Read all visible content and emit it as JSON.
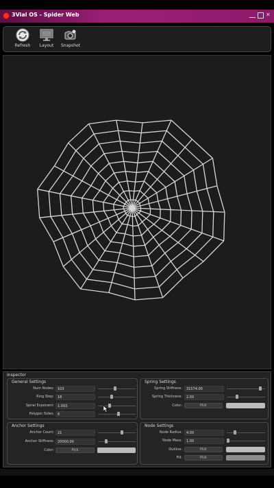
{
  "window": {
    "title": "3Vial OS - Spider Web"
  },
  "toolbar": {
    "refresh": "Refresh",
    "layout": "Layout",
    "snapshot": "Snapshot"
  },
  "inspector": {
    "title": "Inspector",
    "general": {
      "title": "General Settings",
      "num_nodes_label": "Num Nodes:",
      "num_nodes": "103",
      "num_nodes_level": 0.45,
      "ring_step_label": "Ring Step:",
      "ring_step": "18",
      "ring_step_level": 0.35,
      "spiral_exponent_label": "Spiral Exponent:",
      "spiral_exponent": "1.003",
      "spiral_exponent_level": 0.3,
      "polygon_sides_label": "Polygon Sides:",
      "polygon_sides": "6",
      "polygon_sides_level": 0.55
    },
    "spring": {
      "title": "Spring Settings",
      "stiffness_label": "Spring Stiffness:",
      "stiffness": "31574.00",
      "stiffness_level": 0.9,
      "thickness_label": "Spring Thickness:",
      "thickness": "2.00",
      "thickness_level": 0.25,
      "color_label": "Color:",
      "pick": "Pick"
    },
    "anchor": {
      "title": "Anchor Settings",
      "count_label": "Anchor Count:",
      "count": "21",
      "count_level": 0.65,
      "stiffness_label": "Anchor Stiffness:",
      "stiffness": "20000.00",
      "stiffness_level": 0.2,
      "color_label": "Color:",
      "pick": "Pick"
    },
    "node": {
      "title": "Node Settings",
      "radius_label": "Node Radius:",
      "radius": "4.00",
      "radius_level": 0.2,
      "mass_label": "Node Mass:",
      "mass": "1.00",
      "mass_level": 0.0,
      "outline_label": "Outline:",
      "fill_label": "Fill:",
      "pick": "Pick"
    }
  },
  "colors": {
    "title_gradient_start": "#5a0f45",
    "title_gradient_end": "#9b1f77",
    "web_thread": "#d8d8d8",
    "swatch": "#bdbdbd"
  }
}
